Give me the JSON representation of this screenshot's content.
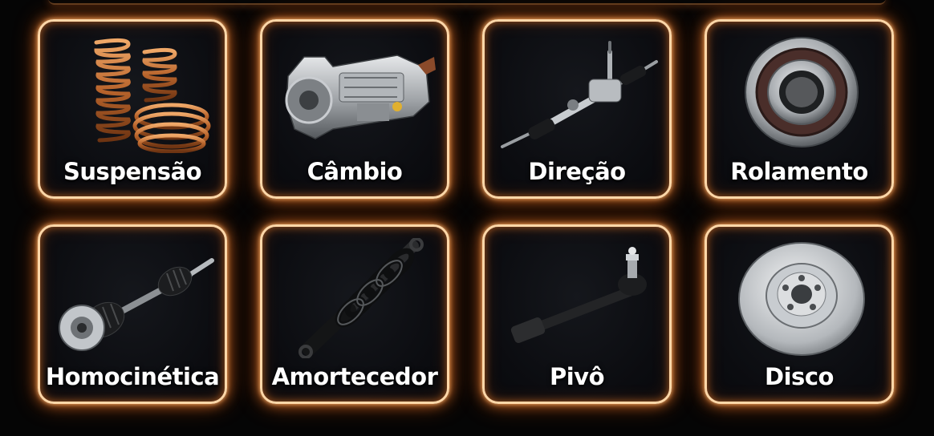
{
  "categories": [
    {
      "label": "Suspensão",
      "icon": "coil-spring-icon"
    },
    {
      "label": "Câmbio",
      "icon": "gearbox-icon"
    },
    {
      "label": "Direção",
      "icon": "steering-rack-icon"
    },
    {
      "label": "Rolamento",
      "icon": "wheel-bearing-icon"
    },
    {
      "label": "Homocinética",
      "icon": "cv-axle-icon"
    },
    {
      "label": "Amortecedor",
      "icon": "shock-absorber-icon"
    },
    {
      "label": "Pivô",
      "icon": "tie-rod-end-icon"
    },
    {
      "label": "Disco",
      "icon": "brake-disc-icon"
    }
  ],
  "colors": {
    "background": "#050505",
    "card_border": "#ffd7a8",
    "glow": "#ff8228",
    "label": "#ffffff"
  }
}
